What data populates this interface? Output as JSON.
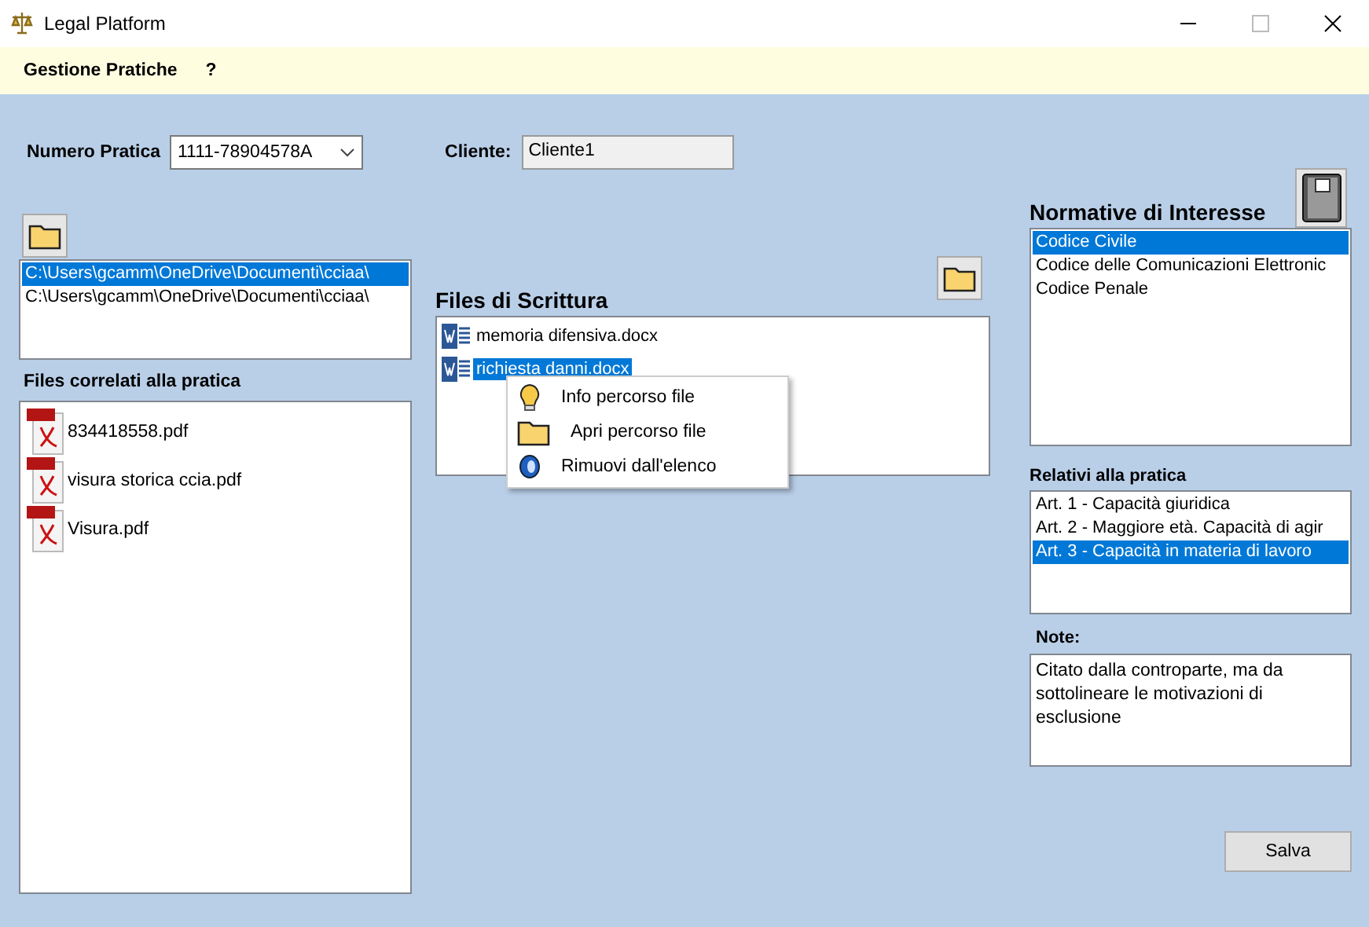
{
  "window": {
    "title": "Legal Platform"
  },
  "menu": [
    {
      "label": "Gestione Pratiche"
    },
    {
      "label": "?"
    }
  ],
  "numero_pratica": {
    "label": "Numero Pratica",
    "value": "1111-78904578A"
  },
  "cliente": {
    "label": "Cliente:",
    "value": "Cliente1"
  },
  "paths": [
    {
      "text": "C:\\Users\\gcamm\\OneDrive\\Documenti\\cciaa\\",
      "selected": true
    },
    {
      "text": "C:\\Users\\gcamm\\OneDrive\\Documenti\\cciaa\\",
      "selected": false
    }
  ],
  "related_files": {
    "label": "Files correlati alla pratica",
    "items": [
      {
        "name": "834418558.pdf"
      },
      {
        "name": "visura storica ccia.pdf"
      },
      {
        "name": "Visura.pdf"
      }
    ]
  },
  "writing_files": {
    "label": "Files di Scrittura",
    "items": [
      {
        "name": "memoria difensiva.docx",
        "selected": false
      },
      {
        "name": "richiesta danni.docx",
        "selected": true
      }
    ]
  },
  "context_menu": [
    {
      "kind": "info",
      "label": "Info percorso file"
    },
    {
      "kind": "open",
      "label": "Apri percorso file"
    },
    {
      "kind": "remove",
      "label": "Rimuovi dall'elenco"
    }
  ],
  "normative": {
    "label": "Normative di Interesse",
    "items": [
      {
        "text": "Codice Civile",
        "selected": true
      },
      {
        "text": "Codice delle Comunicazioni Elettronic",
        "selected": false
      },
      {
        "text": "Codice Penale",
        "selected": false
      }
    ]
  },
  "relativi": {
    "label": "Relativi alla pratica",
    "items": [
      {
        "text": "Art. 1 - Capacità giuridica",
        "selected": false
      },
      {
        "text": "Art. 2 - Maggiore età. Capacità di agir",
        "selected": false
      },
      {
        "text": "Art. 3 - Capacità in materia di lavoro",
        "selected": true
      }
    ]
  },
  "note": {
    "label": "Note:",
    "value": "Citato dalla controparte, ma da sottolineare le motivazioni di esclusione"
  },
  "save_button": "Salva"
}
